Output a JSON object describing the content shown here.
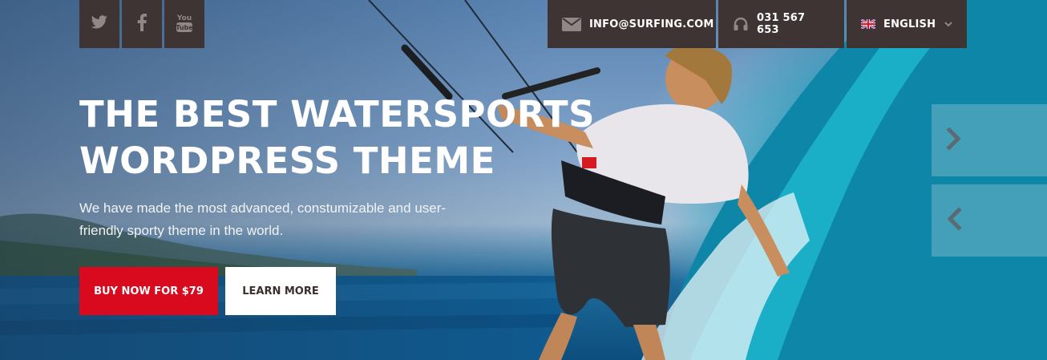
{
  "social": [
    {
      "name": "twitter-icon",
      "label": "Twitter"
    },
    {
      "name": "facebook-icon",
      "label": "Facebook"
    },
    {
      "name": "youtube-icon",
      "label": "You Tube"
    }
  ],
  "topbar": {
    "email": "INFO@SURFING.COM",
    "phone": "031 567 653",
    "language": "ENGLISH"
  },
  "hero": {
    "headline_line1": "THE BEST WATERSPORTS",
    "headline_line2": "WORDPRESS THEME",
    "subtitle": "We have made the most advanced, constumizable and user-friendly sporty theme in the world.",
    "buy_label": "BUY NOW FOR $79",
    "learn_label": "LEARN MORE"
  },
  "slider": {
    "next_icon": "chevron-right-icon",
    "prev_icon": "chevron-left-icon"
  },
  "colors": {
    "topbar_bg": "#3e3433",
    "accent_red": "#d90a1e",
    "white": "#ffffff"
  }
}
